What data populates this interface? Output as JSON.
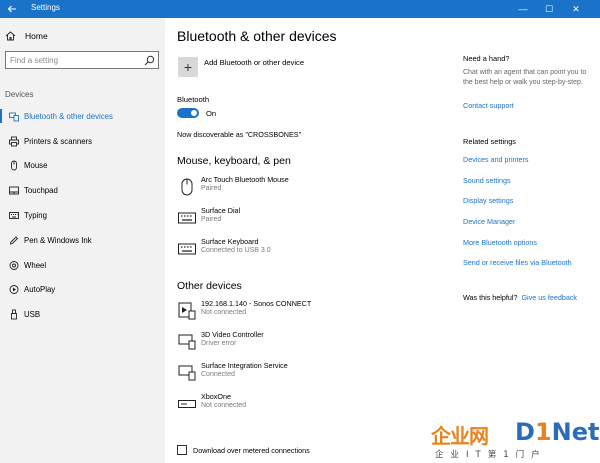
{
  "window": {
    "title": "Settings",
    "back_icon": "back-arrow-icon",
    "controls": {
      "minimize": "—",
      "maximize": "☐",
      "close": "✕"
    }
  },
  "sidebar": {
    "home_label": "Home",
    "search_placeholder": "Find a setting",
    "section_label": "Devices",
    "items": [
      {
        "label": "Bluetooth & other devices",
        "icon": "bluetooth-icon",
        "active": true
      },
      {
        "label": "Printers & scanners",
        "icon": "printer-icon",
        "active": false
      },
      {
        "label": "Mouse",
        "icon": "mouse-icon",
        "active": false
      },
      {
        "label": "Touchpad",
        "icon": "touchpad-icon",
        "active": false
      },
      {
        "label": "Typing",
        "icon": "keyboard-icon",
        "active": false
      },
      {
        "label": "Pen & Windows Ink",
        "icon": "pen-icon",
        "active": false
      },
      {
        "label": "Wheel",
        "icon": "wheel-icon",
        "active": false
      },
      {
        "label": "AutoPlay",
        "icon": "autoplay-icon",
        "active": false
      },
      {
        "label": "USB",
        "icon": "usb-icon",
        "active": false
      }
    ]
  },
  "main": {
    "title": "Bluetooth & other devices",
    "add_device_label": "Add Bluetooth or other device",
    "bluetooth_label": "Bluetooth",
    "toggle_state": "On",
    "discoverable_text": "Now discoverable as \"CROSSBONES\"",
    "mouse_keyboard_pen": {
      "heading": "Mouse, keyboard, & pen",
      "devices": [
        {
          "name": "Arc Touch Bluetooth Mouse",
          "status": "Paired",
          "icon": "mouse-icon"
        },
        {
          "name": "Surface Dial",
          "status": "Paired",
          "icon": "keyboard-icon"
        },
        {
          "name": "Surface Keyboard",
          "status": "Connected to USB 3.0",
          "icon": "keyboard-icon"
        }
      ]
    },
    "other_devices": {
      "heading": "Other devices",
      "devices": [
        {
          "name": "192.168.1.140 - Sonos CONNECT",
          "status": "Not connected",
          "icon": "media-device-icon"
        },
        {
          "name": "3D Video Controller",
          "status": "Driver error",
          "icon": "display-device-icon"
        },
        {
          "name": "Surface Integration Service",
          "status": "Connected",
          "icon": "display-device-icon"
        },
        {
          "name": "XboxOne",
          "status": "Not connected",
          "icon": "console-icon"
        }
      ]
    },
    "metered_label": "Download over metered connections",
    "metered_checked": false
  },
  "aside": {
    "help_heading": "Need a hand?",
    "help_text": "Chat with an agent that can point you to the best help or walk you step-by-step.",
    "contact_support": "Contact support",
    "related_heading": "Related settings",
    "related_links": [
      "Devices and printers",
      "Sound settings",
      "Display settings",
      "Device Manager",
      "More Bluetooth options",
      "Send or receive files via Bluetooth"
    ],
    "helpful_question": "Was this helpful?",
    "give_feedback": "Give us feedback"
  },
  "watermark": {
    "brand_cn": "企业网",
    "brand_d": "D",
    "brand_one": "1",
    "brand_net": "Net",
    "subtitle": "企业IT第1门户"
  },
  "colors": {
    "accent": "#1a73c9",
    "sidebar_bg": "#f2f2f2",
    "watermark_orange": "#e8821e",
    "watermark_blue": "#2a6cb8"
  }
}
